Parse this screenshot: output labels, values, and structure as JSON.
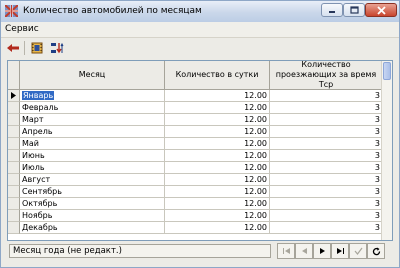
{
  "window": {
    "title": "Количество автомобилей по месяцам"
  },
  "menu": {
    "items": [
      "Сервис"
    ]
  },
  "toolbar": {
    "icons": [
      "back-arrow-icon",
      "film-strip-icon",
      "sort-icon"
    ]
  },
  "grid": {
    "headers": {
      "month": "Месяц",
      "count": "Количество в сутки",
      "passing": "Количество проезжающих за время Tср"
    },
    "rows": [
      {
        "month": "Январь",
        "count": "12.00",
        "passing": "3"
      },
      {
        "month": "Февраль",
        "count": "12.00",
        "passing": "3"
      },
      {
        "month": "Март",
        "count": "12.00",
        "passing": "3"
      },
      {
        "month": "Апрель",
        "count": "12.00",
        "passing": "3"
      },
      {
        "month": "Май",
        "count": "12.00",
        "passing": "3"
      },
      {
        "month": "Июнь",
        "count": "12.00",
        "passing": "3"
      },
      {
        "month": "Июль",
        "count": "12.00",
        "passing": "3"
      },
      {
        "month": "Август",
        "count": "12.00",
        "passing": "3"
      },
      {
        "month": "Сентябрь",
        "count": "12.00",
        "passing": "3"
      },
      {
        "month": "Октябрь",
        "count": "12.00",
        "passing": "3"
      },
      {
        "month": "Ноябрь",
        "count": "12.00",
        "passing": "3"
      },
      {
        "month": "Декабрь",
        "count": "12.00",
        "passing": "3"
      }
    ]
  },
  "status": {
    "text": "Месяц года (не редакт.)"
  },
  "navigator": {
    "buttons": [
      "first-icon",
      "prior-icon",
      "next-icon",
      "last-icon",
      "post-icon",
      "refresh-icon"
    ]
  },
  "colors": {
    "selection": "#316ac5",
    "title_gradient_top": "#e8eef8",
    "title_gradient_bottom": "#bccde5",
    "close_button": "#c8442d"
  }
}
